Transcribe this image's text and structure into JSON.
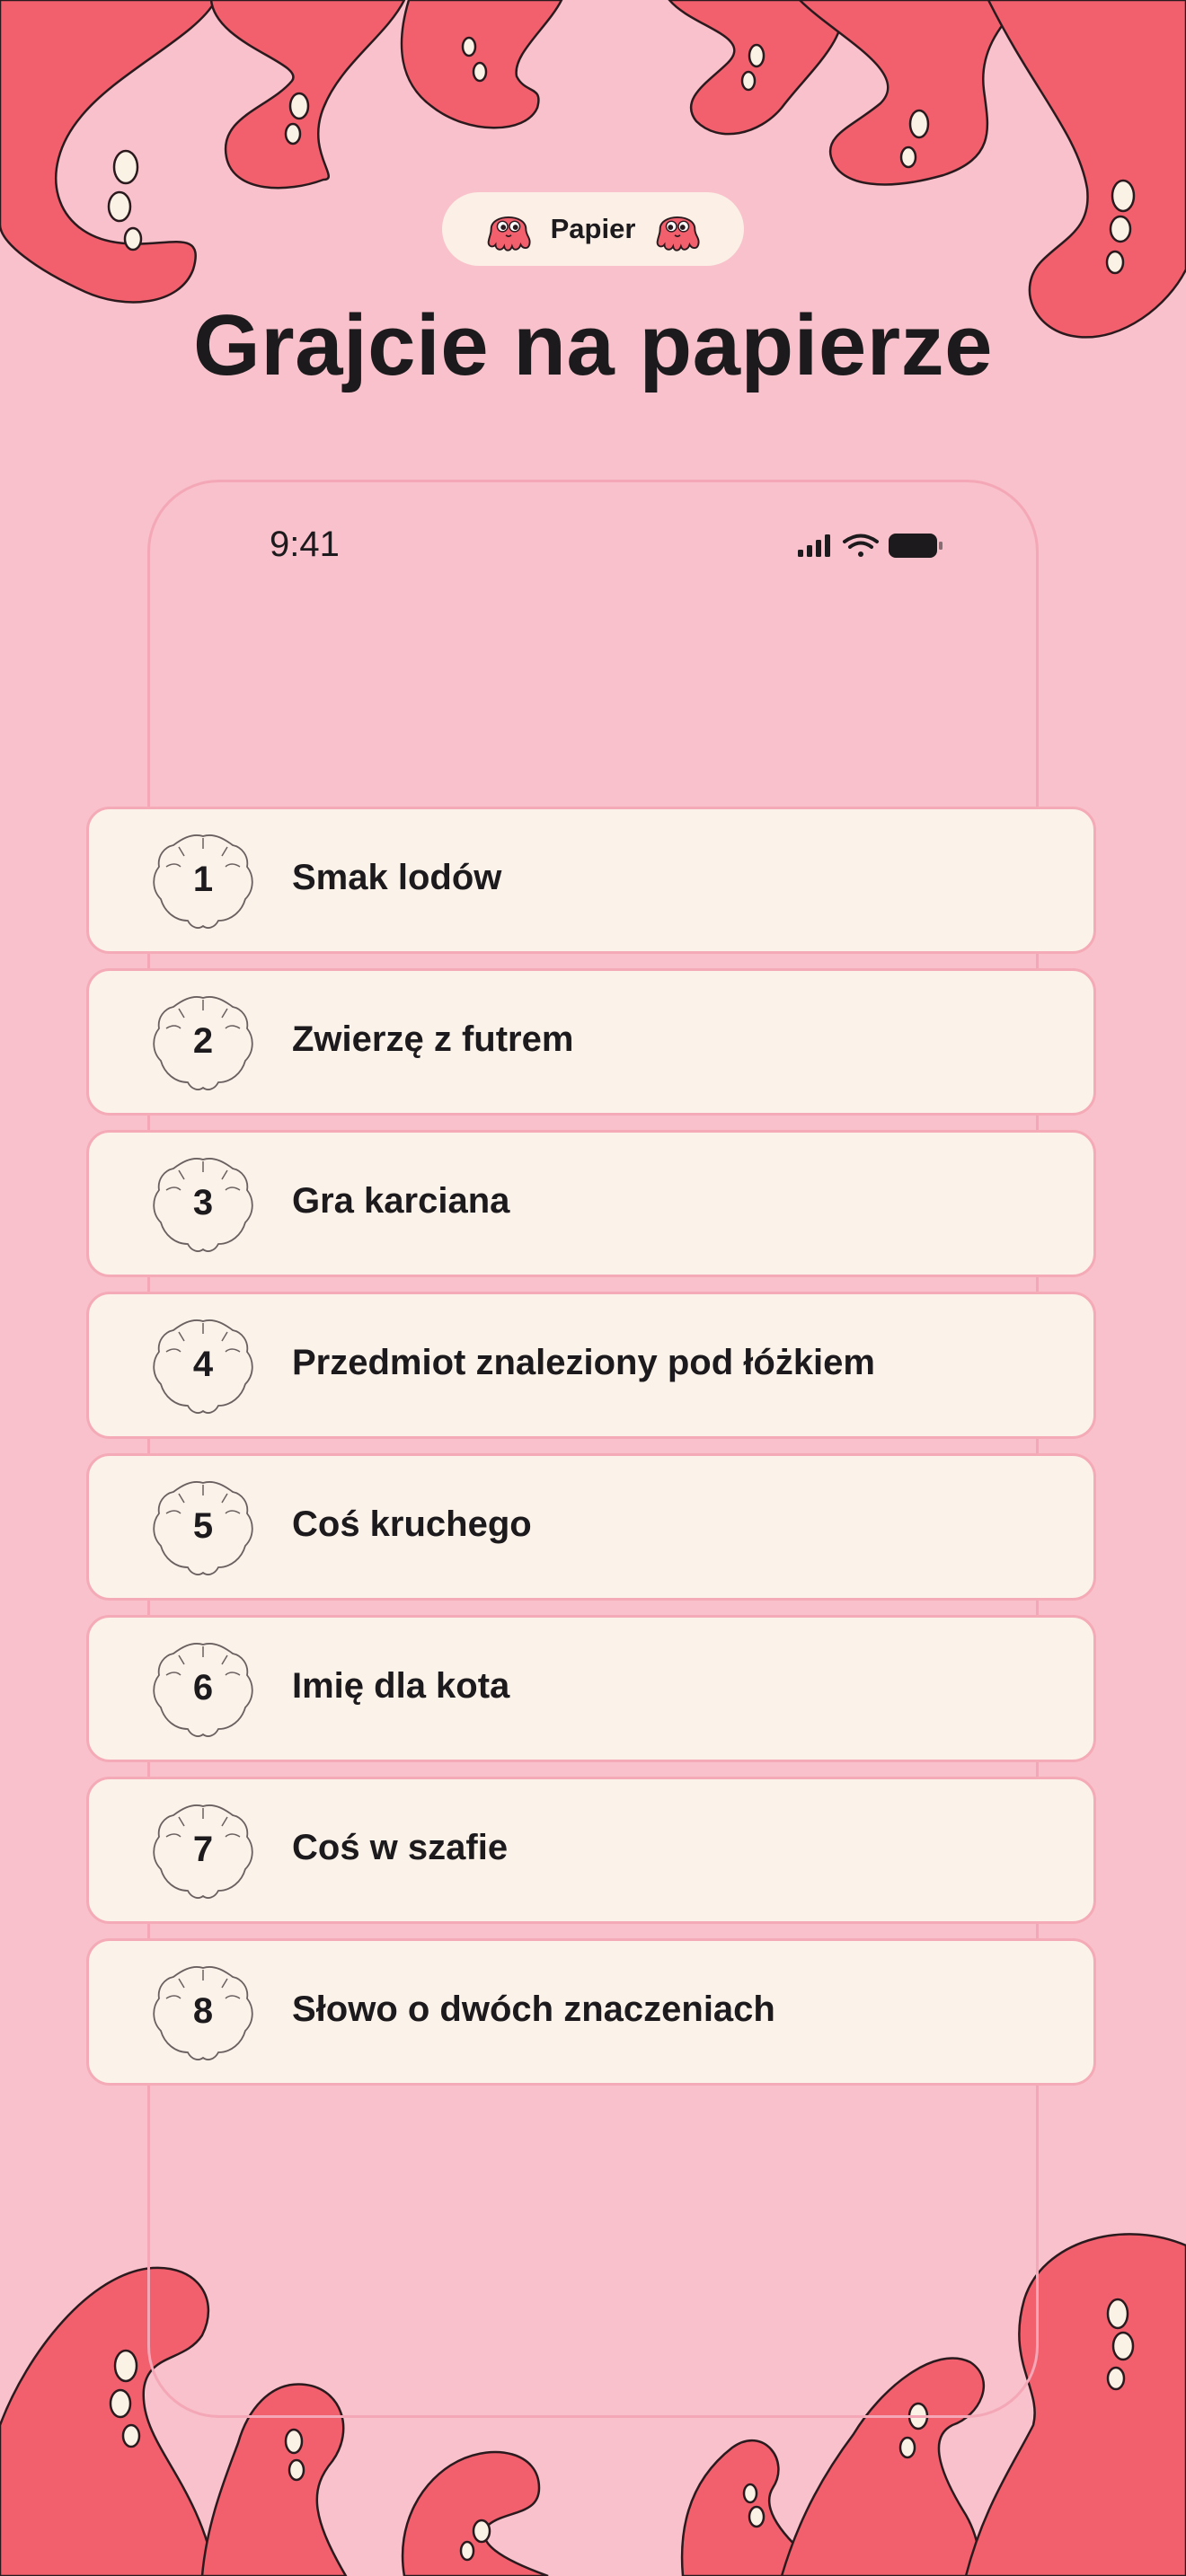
{
  "header": {
    "category_label": "Papier",
    "category_icon": "octopus-icon",
    "title": "Grajcie na papierze"
  },
  "status_bar": {
    "time": "9:41",
    "icons": [
      "cellular-signal-icon",
      "wifi-icon",
      "battery-icon"
    ]
  },
  "prompts": [
    {
      "number": "1",
      "label": "Smak lodów"
    },
    {
      "number": "2",
      "label": "Zwierzę z futrem"
    },
    {
      "number": "3",
      "label": "Gra karciana"
    },
    {
      "number": "4",
      "label": "Przedmiot znaleziony pod łóżkiem"
    },
    {
      "number": "5",
      "label": "Coś kruchego"
    },
    {
      "number": "6",
      "label": "Imię dla kota"
    },
    {
      "number": "7",
      "label": "Coś w szafie"
    },
    {
      "number": "8",
      "label": "Słowo o dwóch znaczeniach"
    }
  ],
  "colors": {
    "background": "#f8c1cb",
    "tentacle": "#f2606e",
    "card": "#fbf2e9",
    "card_border": "#f4aab7",
    "text": "#1c1a1c"
  }
}
